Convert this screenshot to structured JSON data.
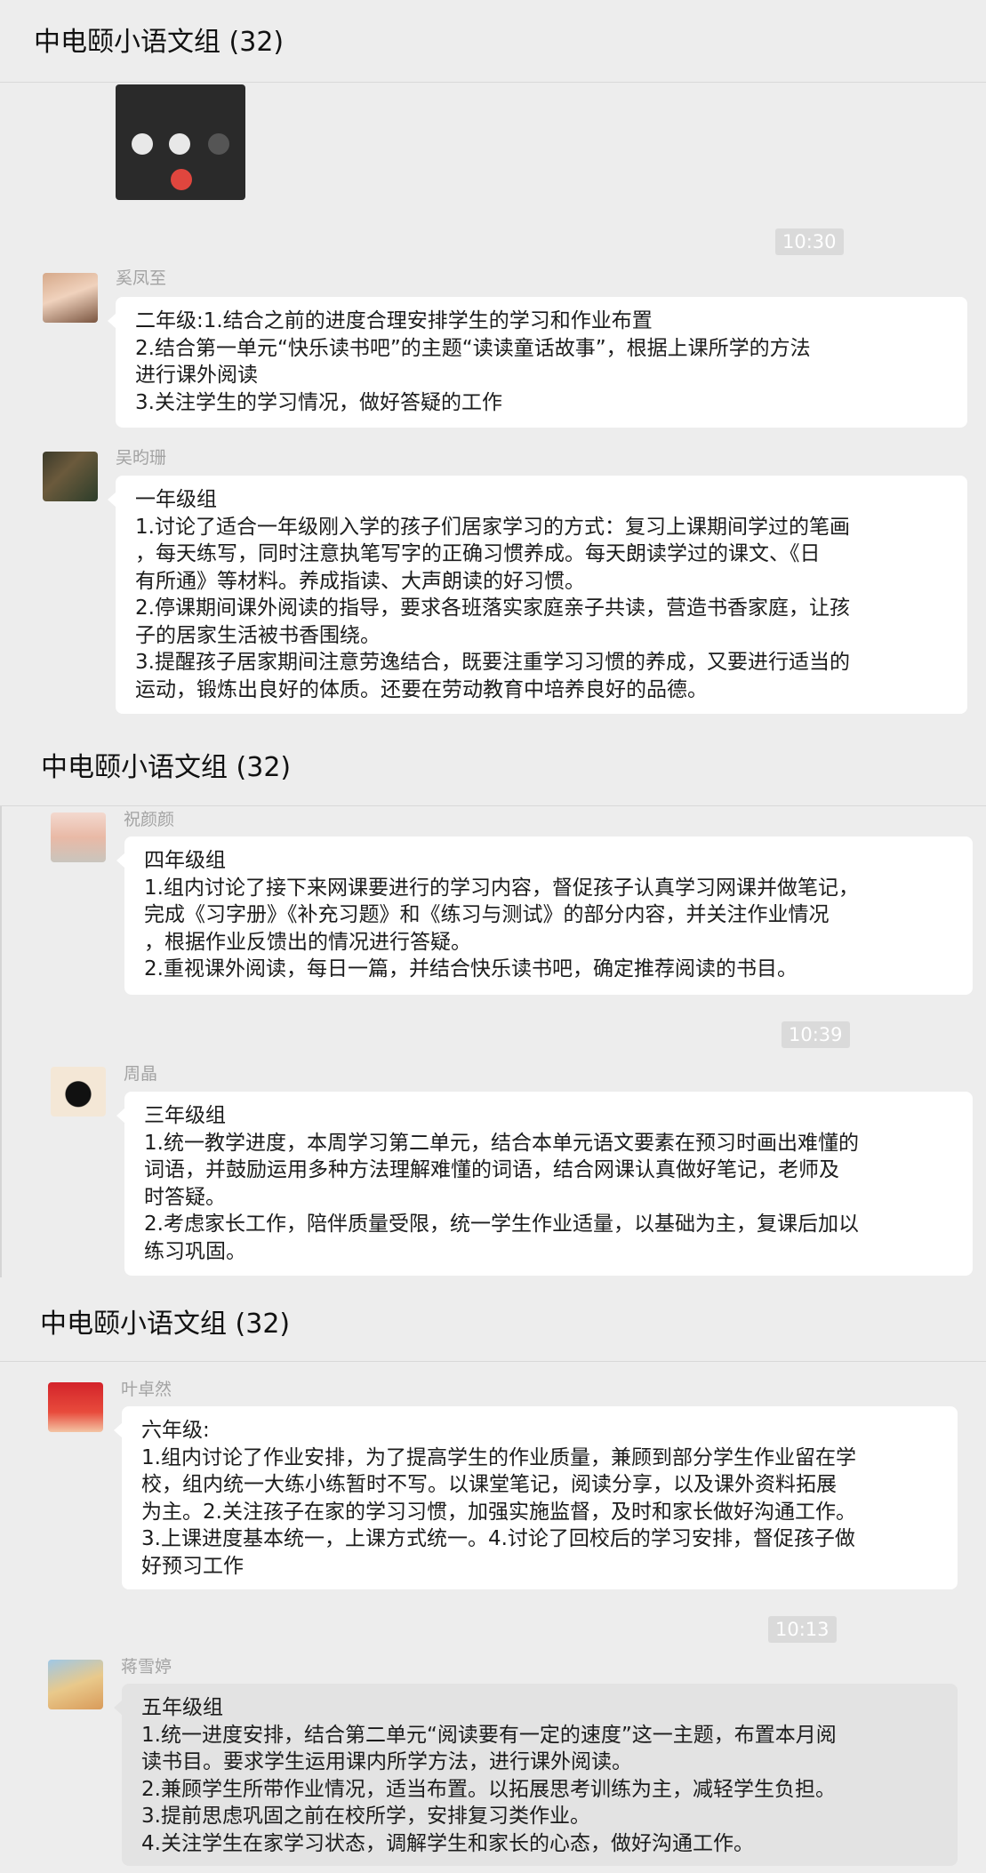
{
  "group_title": "中电颐小语文组 (32)",
  "section1": {
    "timestamp": "10:30",
    "msg1": {
      "sender": "奚凤至",
      "lines": [
        "二年级:1.结合之前的进度合理安排学生的学习和作业布置",
        "2.结合第一单元“快乐读书吧”的主题“读读童话故事”，根据上课所学的方法",
        "进行课外阅读",
        "3.关注学生的学习情况，做好答疑的工作"
      ]
    },
    "msg2": {
      "sender": "吴昀珊",
      "lines": [
        "一年级组",
        "1.讨论了适合一年级刚入学的孩子们居家学习的方式：复习上课期间学过的笔画",
        "，每天练写，同时注意执笔写字的正确习惯养成。每天朗读学过的课文、《日",
        "有所通》等材料。养成指读、大声朗读的好习惯。",
        "2.停课期间课外阅读的指导，要求各班落实家庭亲子共读，营造书香家庭，让孩",
        "子的居家生活被书香围绕。",
        "3.提醒孩子居家期间注意劳逸结合，既要注重学习习惯的养成，又要进行适当的",
        "运动，锻炼出良好的体质。还要在劳动教育中培养良好的品德。"
      ]
    }
  },
  "section2": {
    "timestamp": "10:39",
    "msg1": {
      "sender": "祝颜颜",
      "lines": [
        "四年级组",
        "1.组内讨论了接下来网课要进行的学习内容，督促孩子认真学习网课并做笔记，",
        "完成《习字册》《补充习题》和《练习与测试》的部分内容，并关注作业情况",
        "，根据作业反馈出的情况进行答疑。",
        "2.重视课外阅读，每日一篇，并结合快乐读书吧，确定推荐阅读的书目。"
      ]
    },
    "msg2": {
      "sender": "周晶",
      "lines": [
        "三年级组",
        "1.统一教学进度，本周学习第二单元，结合本单元语文要素在预习时画出难懂的",
        "词语，并鼓励运用多种方法理解难懂的词语，结合网课认真做好笔记，老师及",
        "时答疑。",
        "2.考虑家长工作，陪伴质量受限，统一学生作业适量，以基础为主，复课后加以",
        "练习巩固。"
      ]
    }
  },
  "section3": {
    "timestamp": "10:13",
    "msg1": {
      "sender": "叶卓然",
      "lines": [
        "六年级:",
        "1.组内讨论了作业安排，为了提高学生的作业质量，兼顾到部分学生作业留在学",
        "校，组内统一大练小练暂时不写。以课堂笔记，阅读分享，以及课外资料拓展",
        "为主。2.关注孩子在家的学习习惯，加强实施监督，及时和家长做好沟通工作。",
        "3.上课进度基本统一，上课方式统一。4.讨论了回校后的学习安排，督促孩子做",
        "好预习工作"
      ]
    },
    "msg2": {
      "sender": "蒋雪婷",
      "lines": [
        "五年级组",
        "1.统一进度安排，结合第二单元“阅读要有一定的速度”这一主题，布置本月阅",
        "读书目。要求学生运用课内所学方法，进行课外阅读。",
        "2.兼顾学生所带作业情况，适当布置。以拓展思考训练为主，减轻学生负担。",
        "3.提前思虑巩固之前在校所学，安排复习类作业。",
        "4.关注学生在家学习状态，调解学生和家长的心态，做好沟通工作。"
      ]
    }
  },
  "colors": {
    "chat_bg": "#ededed",
    "bubble": "#ffffff",
    "selected_bubble": "#e3e3e3",
    "sender_name": "#a3a3a3"
  }
}
